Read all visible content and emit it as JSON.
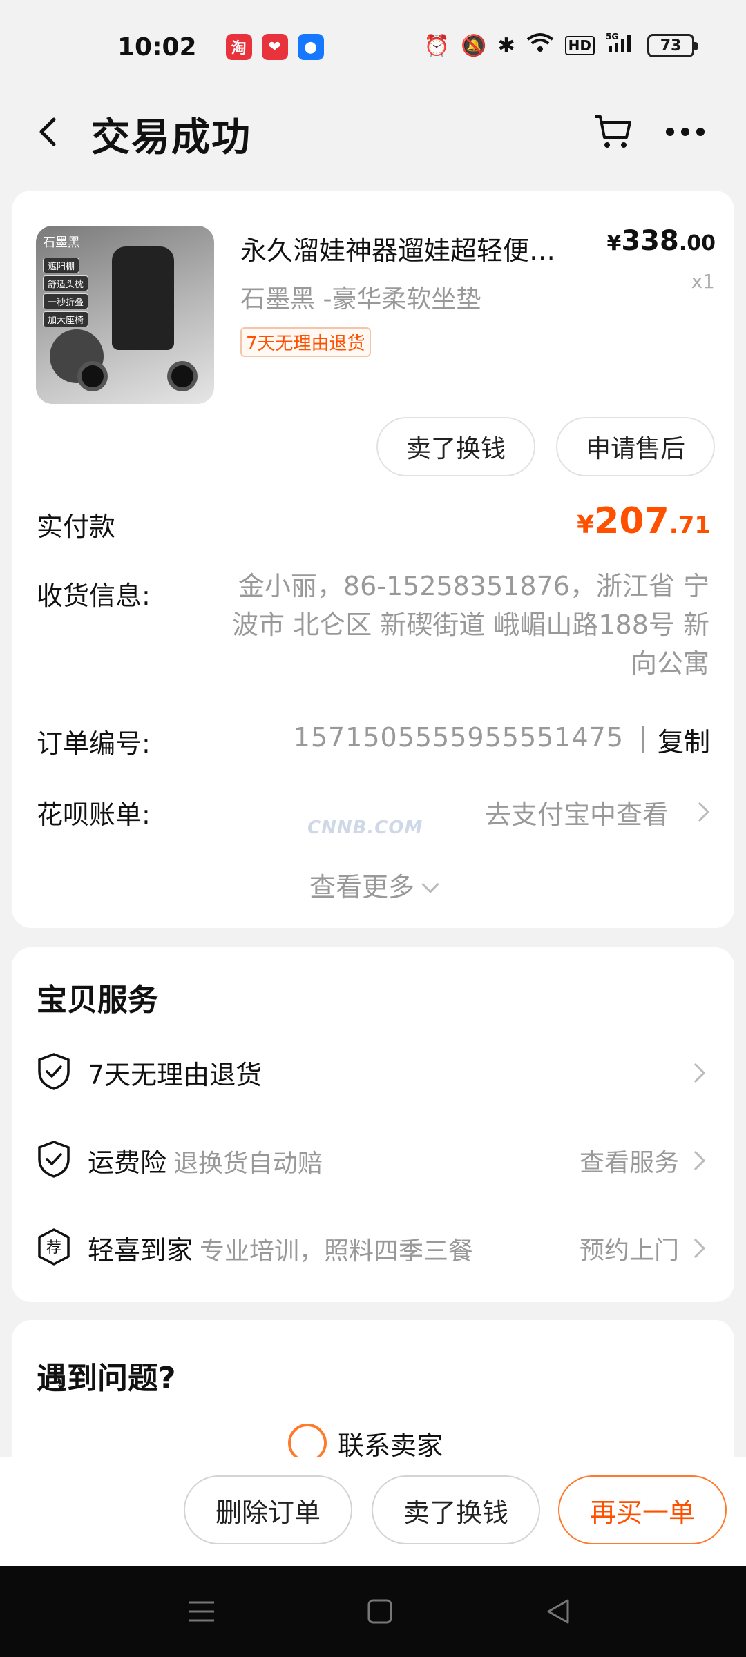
{
  "status_bar": {
    "time": "10:02",
    "apps": [
      {
        "icon": "taobao-app-icon",
        "glyph": "淘",
        "color": "#e8323c"
      },
      {
        "icon": "heart-app-icon",
        "glyph": "❤",
        "color": "#e8323c"
      },
      {
        "icon": "robot-app-icon",
        "glyph": "●",
        "color": "#1677ff"
      }
    ],
    "battery": "73",
    "network": "5G"
  },
  "header": {
    "title": "交易成功"
  },
  "order": {
    "product": {
      "image_label": "石墨黑",
      "image_features": [
        "遮阳棚",
        "舒适头枕",
        "一秒折叠",
        "加大座椅"
      ],
      "title": "永久溜娃神器遛娃超轻便…",
      "price_currency": "¥",
      "price_int": "338",
      "price_dec": ".00",
      "qty": "x1",
      "spec": "石墨黑 -豪华柔软坐垫",
      "tag": "7天无理由退货"
    },
    "actions": {
      "sell": "卖了换钱",
      "after_sale": "申请售后"
    },
    "paid": {
      "label": "实付款",
      "currency": "¥",
      "int": "207",
      "dec": ".71"
    },
    "shipping": {
      "label": "收货信息:",
      "value": "金小丽，86-15258351876，浙江省 宁波市 北仑区 新碶街道 峨嵋山路188号 新向公寓"
    },
    "order_no": {
      "label": "订单编号:",
      "value": "1571505555955551475",
      "separator": "|",
      "copy": "复制"
    },
    "huabei": {
      "label": "花呗账单:",
      "link": "去支付宝中查看"
    },
    "watermark": "CNNB.COM",
    "more": "查看更多"
  },
  "service": {
    "title": "宝贝服务",
    "items": [
      {
        "icon": "shield-check-icon",
        "name": "7天无理由退货",
        "desc": "",
        "link": ""
      },
      {
        "icon": "shield-check-icon",
        "name": "运费险",
        "desc": "退换货自动赔",
        "link": "查看服务"
      },
      {
        "icon": "recommend-badge-icon",
        "badge": "荐",
        "name": "轻喜到家",
        "desc": "专业培训，照料四季三餐",
        "link": "预约上门"
      }
    ]
  },
  "problem": {
    "title": "遇到问题?",
    "contact": "联系卖家"
  },
  "bottom_bar": {
    "delete": "删除订单",
    "sell": "卖了换钱",
    "rebuy": "再买一单"
  },
  "colors": {
    "accent": "#ff5000",
    "muted": "#999999",
    "background": "#f2f2f2"
  }
}
